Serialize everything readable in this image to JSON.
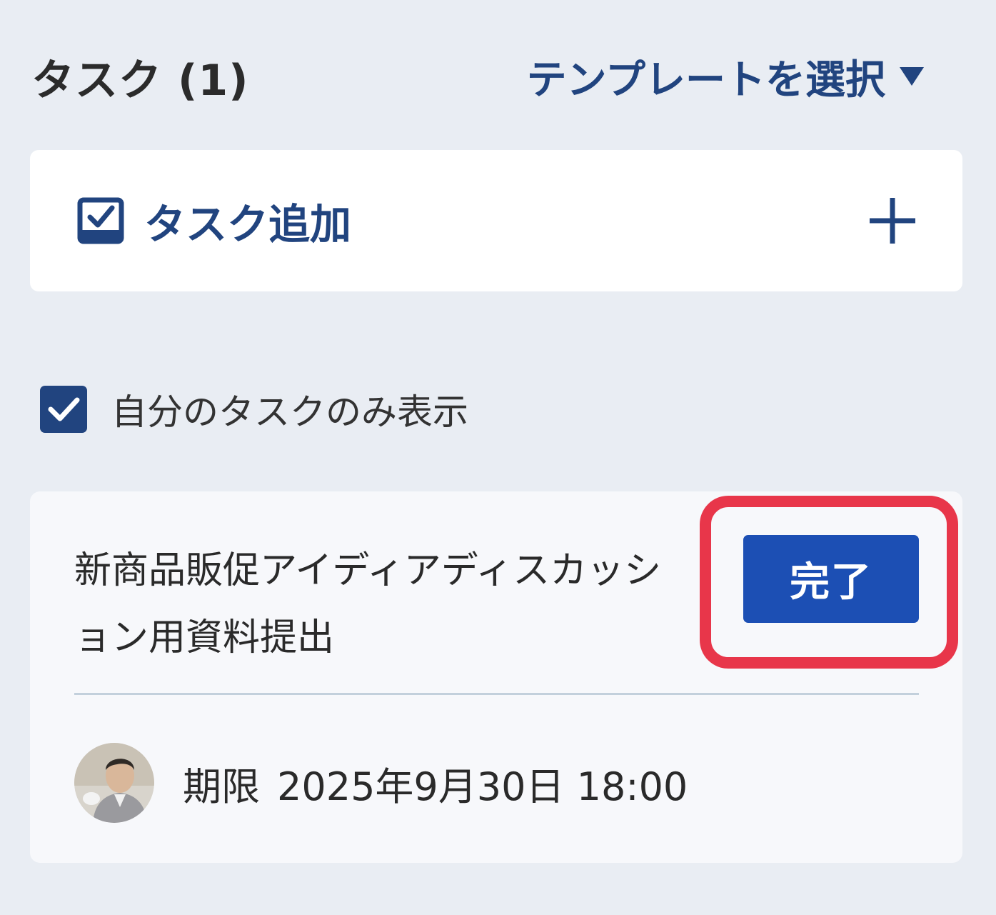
{
  "header": {
    "title": "タスク",
    "count": "(1)",
    "template_select_label": "テンプレートを選択"
  },
  "add_task": {
    "label": "タスク追加"
  },
  "filter": {
    "label": "自分のタスクのみ表示",
    "checked": true
  },
  "task": {
    "title": "新商品販促アイディアディスカッション用資料提出",
    "complete_label": "完了",
    "due_label": "期限",
    "due_value": "2025年9月30日 18:00"
  },
  "colors": {
    "accent": "#21447f",
    "button": "#1c4fb4",
    "highlight": "#e8364a",
    "background": "#e9edf3"
  },
  "icons": {
    "template_caret": "caret-down-icon",
    "add_task": "checkbox-checked-icon",
    "add": "plus-icon",
    "avatar": "user-avatar"
  }
}
